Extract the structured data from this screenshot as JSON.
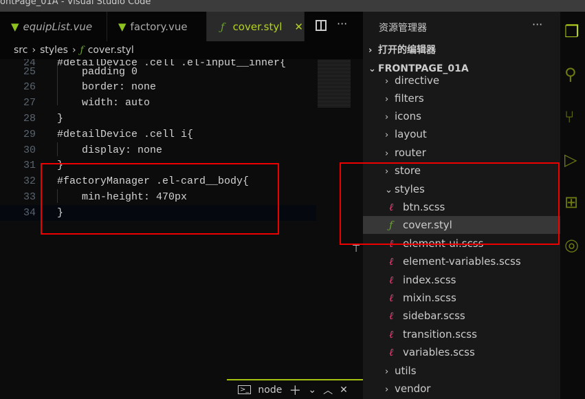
{
  "window": {
    "title": "ontPage_01A - Visual Studio Code"
  },
  "tabs": [
    {
      "label": "equipList.vue",
      "icon": "vue-icon"
    },
    {
      "label": "factory.vue",
      "icon": "vue-icon"
    },
    {
      "label": "cover.styl",
      "icon": "stylus-icon",
      "active": true
    }
  ],
  "breadcrumb": [
    "src",
    "styles",
    "cover.styl"
  ],
  "editor": {
    "lines": [
      {
        "n": "24",
        "code": "#detailDevice .cell .el-input__inner{"
      },
      {
        "n": "25",
        "code": "    padding 0"
      },
      {
        "n": "26",
        "code": "    border: none"
      },
      {
        "n": "27",
        "code": "    width: auto"
      },
      {
        "n": "28",
        "code": "}"
      },
      {
        "n": "29",
        "code": "#detailDevice .cell i{"
      },
      {
        "n": "30",
        "code": "    display: none"
      },
      {
        "n": "31",
        "code": "}"
      },
      {
        "n": "32",
        "code": "#factoryManager .el-card__body{"
      },
      {
        "n": "33",
        "code": "    min-height: 470px"
      },
      {
        "n": "34",
        "code": "}"
      }
    ]
  },
  "explorer": {
    "title": "资源管理器",
    "open_editors": "打开的编辑器",
    "project": "FRONTPAGE_01A",
    "items": [
      {
        "label": "directive",
        "type": "folder"
      },
      {
        "label": "filters",
        "type": "folder"
      },
      {
        "label": "icons",
        "type": "folder"
      },
      {
        "label": "layout",
        "type": "folder"
      },
      {
        "label": "router",
        "type": "folder"
      },
      {
        "label": "store",
        "type": "folder"
      },
      {
        "label": "styles",
        "type": "folder-open"
      },
      {
        "label": "btn.scss",
        "type": "scss"
      },
      {
        "label": "cover.styl",
        "type": "styl",
        "selected": true
      },
      {
        "label": "element-ui.scss",
        "type": "scss"
      },
      {
        "label": "element-variables.scss",
        "type": "scss"
      },
      {
        "label": "index.scss",
        "type": "scss"
      },
      {
        "label": "mixin.scss",
        "type": "scss"
      },
      {
        "label": "sidebar.scss",
        "type": "scss"
      },
      {
        "label": "transition.scss",
        "type": "scss"
      },
      {
        "label": "variables.scss",
        "type": "scss"
      },
      {
        "label": "utils",
        "type": "folder"
      },
      {
        "label": "vendor",
        "type": "folder"
      }
    ]
  },
  "panel": {
    "terminal": "node"
  },
  "colors": {
    "accent": "#a6c10f",
    "scss": "#e2457a",
    "highlight": "#ff0000"
  }
}
